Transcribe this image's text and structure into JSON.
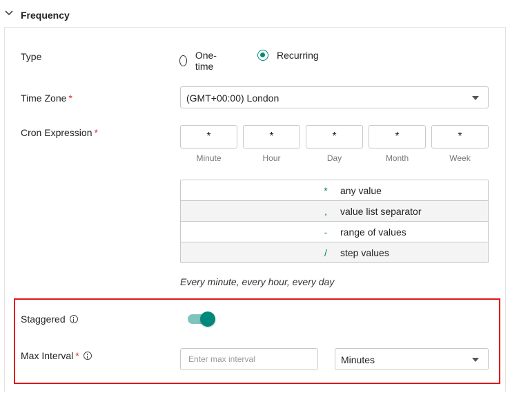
{
  "section": {
    "title": "Frequency"
  },
  "type_field": {
    "label": "Type",
    "options": [
      {
        "label": "One-time",
        "selected": false
      },
      {
        "label": "Recurring",
        "selected": true
      }
    ]
  },
  "time_zone": {
    "label": "Time Zone",
    "required_mark": "*",
    "value": "(GMT+00:00) London"
  },
  "cron": {
    "label": "Cron Expression",
    "required_mark": "*",
    "fields": [
      {
        "value": "*",
        "caption": "Minute"
      },
      {
        "value": "*",
        "caption": "Hour"
      },
      {
        "value": "*",
        "caption": "Day"
      },
      {
        "value": "*",
        "caption": "Month"
      },
      {
        "value": "*",
        "caption": "Week"
      }
    ],
    "legend": [
      {
        "symbol": "*",
        "description": "any value"
      },
      {
        "symbol": ",",
        "description": "value list separator"
      },
      {
        "symbol": "-",
        "description": "range of values"
      },
      {
        "symbol": "/",
        "description": "step values"
      }
    ],
    "human_readable": "Every minute, every hour, every day"
  },
  "staggered": {
    "label": "Staggered",
    "enabled": true
  },
  "max_interval": {
    "label": "Max Interval",
    "required_mark": "*",
    "placeholder": "Enter max interval",
    "unit_value": "Minutes"
  },
  "colors": {
    "accent": "#00897b",
    "accent_light": "#7fc4bc",
    "required": "#d32f2f",
    "highlight": "#e0151b"
  }
}
